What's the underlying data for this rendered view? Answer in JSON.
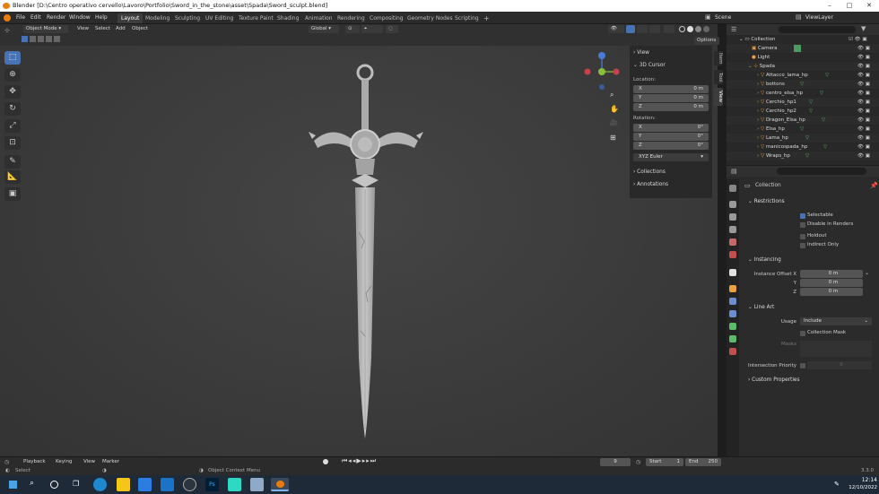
{
  "window": {
    "title": "Blender [D:\\Centro operativo cervello\\Lavoro\\Portfolio\\Sword_in_the_stone\\asset\\Spada\\Sword_sculpt.blend]"
  },
  "menus": [
    "File",
    "Edit",
    "Render",
    "Window",
    "Help"
  ],
  "workspaces": [
    "Layout",
    "Modeling",
    "Sculpting",
    "UV Editing",
    "Texture Paint",
    "Shading",
    "Animation",
    "Rendering",
    "Compositing",
    "Geometry Nodes",
    "Scripting"
  ],
  "scene": {
    "scene_label": "Scene",
    "view_layer_label": "ViewLayer"
  },
  "viewport_header": {
    "mode": "Object Mode",
    "view": "View",
    "select": "Select",
    "add": "Add",
    "object": "Object",
    "orientation": "Global",
    "options": "Options"
  },
  "npanel": {
    "view": "View",
    "cursor": "3D Cursor",
    "location_label": "Location:",
    "location": [
      {
        "k": "X",
        "v": "0 m"
      },
      {
        "k": "Y",
        "v": "0 m"
      },
      {
        "k": "Z",
        "v": "0 m"
      }
    ],
    "rotation_label": "Rotation:",
    "rotation": [
      {
        "k": "X",
        "v": "0°"
      },
      {
        "k": "Y",
        "v": "0°"
      },
      {
        "k": "Z",
        "v": "0°"
      }
    ],
    "rotation_mode": "XYZ Euler",
    "collections": "Collections",
    "annotations": "Annotations",
    "tabs": [
      "Item",
      "Tool",
      "View"
    ]
  },
  "outliner": {
    "collection": "Collection",
    "items": [
      "Camera",
      "Light",
      "Spada",
      "Attacco_lama_hp",
      "bottons",
      "centro_elsa_hp",
      "Cerchio_hp1",
      "Cerchio_hp2",
      "Dragon_Elsa_hp",
      "Elsa_hp",
      "Lama_hp",
      "manicospada_hp",
      "Wraps_hp"
    ]
  },
  "properties": {
    "header": "Collection",
    "restrictions": "Restrictions",
    "selectable": "Selectable",
    "disable_renders": "Disable in Renders",
    "holdout": "Holdout",
    "indirect_only": "Indirect Only",
    "instancing": "Instancing",
    "instance_offset_x": "Instance Offset X",
    "y": "Y",
    "z": "Z",
    "offset_values": [
      "0 m",
      "0 m",
      "0 m"
    ],
    "line_art": "Line Art",
    "usage_label": "Usage",
    "usage_value": "Include",
    "collection_mask": "Collection Mask",
    "masks": "Masks",
    "intersection_priority": "Intersection Priority",
    "intersection_value": "0",
    "custom_properties": "Custom Properties"
  },
  "timeline": {
    "playback": "Playback",
    "keying": "Keying",
    "view": "View",
    "marker": "Marker",
    "current_frame": "9",
    "start_label": "Start",
    "start": "1",
    "end_label": "End",
    "end": "250"
  },
  "status": {
    "select": "Select",
    "context_menu": "Object Context Menu",
    "version": "3.3.0"
  },
  "taskbar": {
    "time": "12:14",
    "date": "12/10/2022"
  },
  "colors": {
    "accent": "#4772b3",
    "orange": "#e87d0d",
    "viewport": "#3d3d3d"
  }
}
